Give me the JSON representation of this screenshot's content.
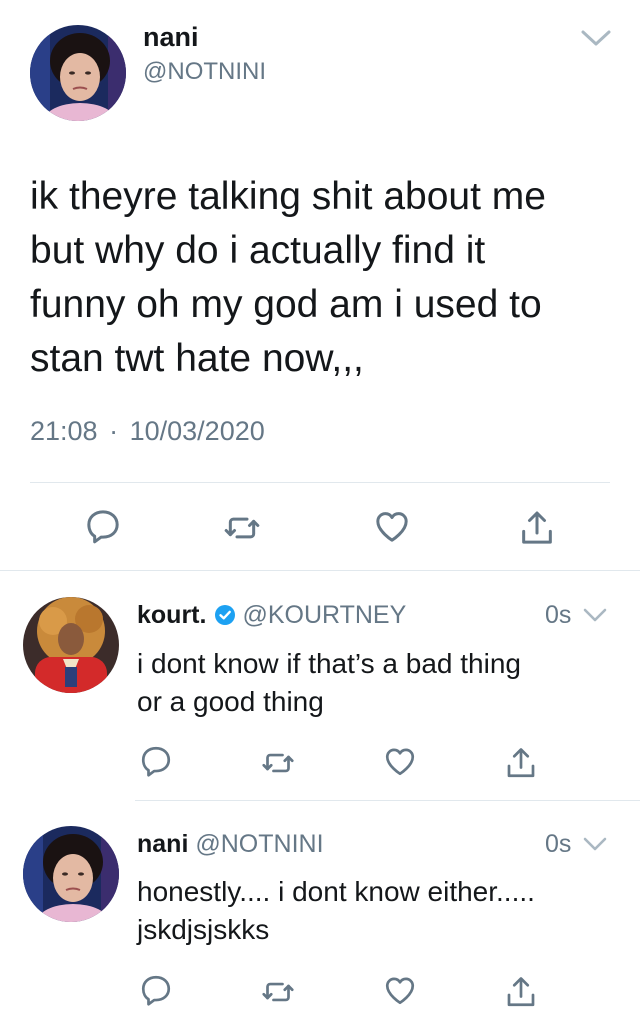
{
  "main_tweet": {
    "name": "nani",
    "handle": "@NOTNINI",
    "text": "ik theyre talking shit about me\nbut why do i actually find it\nfunny oh my god am i used to\nstan twt hate now,,,",
    "time": "21:08",
    "separator": "·",
    "date": "10/03/2020",
    "actions": [
      "reply-icon",
      "retweet-icon",
      "like-icon",
      "share-icon"
    ]
  },
  "replies": [
    {
      "name": "kourt.",
      "verified": true,
      "handle": "@KOURTNEY",
      "time": "0s",
      "text": "i dont know if that’s a bad thing\nor a good thing"
    },
    {
      "name": "nani",
      "verified": false,
      "handle": "@NOTNINI",
      "time": "0s",
      "text": "honestly.... i dont know either.....\njskdjsjskks"
    }
  ],
  "colors": {
    "text": "#14171a",
    "secondary": "#657786",
    "divider": "#e1e8ed",
    "verified_blue": "#1da1f2"
  }
}
